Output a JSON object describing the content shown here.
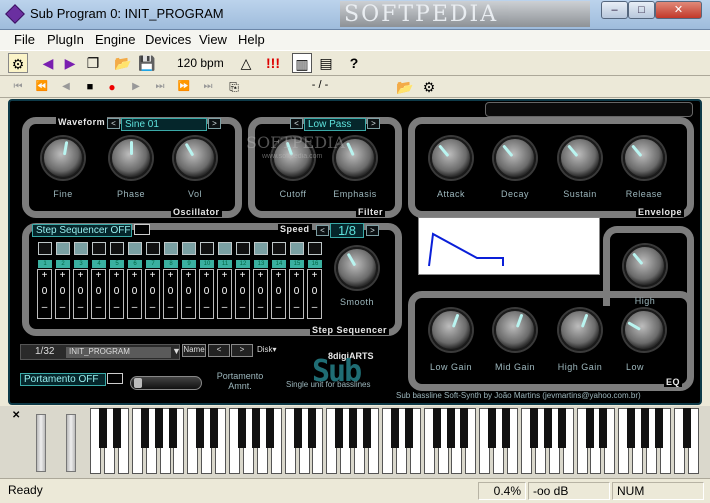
{
  "window": {
    "title": "Sub Program 0: INIT_PROGRAM",
    "watermark": "SOFTPEDIA",
    "min": "–",
    "max": "□",
    "close": "✕"
  },
  "menu": [
    "File",
    "PlugIn",
    "Engine",
    "Devices",
    "View",
    "Help"
  ],
  "toolbar": {
    "tempo": "120 bpm",
    "marker": "!!!",
    "help": "?"
  },
  "transport": {
    "position": "- / -"
  },
  "synth": {
    "oscillator": {
      "label": "Oscillator",
      "waveform_label": "Waveform",
      "waveform": "Sine 01",
      "knobs": [
        "Fine",
        "Phase",
        "Vol"
      ]
    },
    "filter": {
      "label": "Filter",
      "type": "Low Pass",
      "knobs": [
        "Cutoff",
        "Emphasis"
      ]
    },
    "envelope": {
      "label": "Envelope",
      "knobs": [
        "Attack",
        "Decay",
        "Sustain",
        "Release"
      ]
    },
    "step_sequencer": {
      "label": "Step Sequencer",
      "toggle": "Step Sequencer OFF",
      "speed_label": "Speed",
      "speed": "1/8",
      "smooth_label": "Smooth",
      "steps": [
        "1",
        "2",
        "3",
        "4",
        "5",
        "6",
        "7",
        "8",
        "9",
        "10",
        "11",
        "12",
        "13",
        "14",
        "15",
        "16"
      ],
      "lights_on": [
        2,
        3,
        6,
        8,
        9,
        11,
        13,
        15
      ],
      "plus": "+",
      "value": "0",
      "minus": "–"
    },
    "eq": {
      "label": "EQ",
      "knobs": [
        "Low Gain",
        "Mid Gain",
        "High Gain",
        "Low",
        "High"
      ]
    },
    "program": {
      "index": "1/32",
      "name": "INIT_PROGRAM",
      "name_btn": "Name",
      "prev": "<",
      "next": ">",
      "disk": "Disk▾"
    },
    "portamento": {
      "toggle": "Portamento OFF",
      "label": "Portamento Amnt."
    },
    "brand": {
      "maker": "8digiARTS",
      "logo": "Sub",
      "tag": "Single unit for basslines",
      "credit": "Sub bassline Soft-Synth by João Martins (jevmartins@yahoo.com.br)"
    },
    "watermark": "SOFTPEDIA",
    "watermark_url": "www.softpedia.com"
  },
  "status": {
    "left": "Ready",
    "cpu": "0.4%",
    "level": "-oo dB",
    "num": "NUM"
  }
}
